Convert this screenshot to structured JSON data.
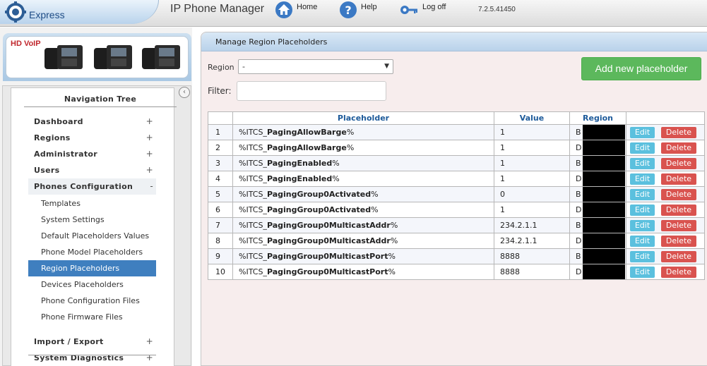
{
  "header": {
    "brand": "Express",
    "title": "IP Phone Manager",
    "home_label": "Home",
    "help_label": "Help",
    "logoff_label": "Log off",
    "version": "7.2.5.41450"
  },
  "banner": {
    "logo_text": "HD VoIP"
  },
  "nav": {
    "title": "Navigation Tree",
    "items": [
      {
        "label": "Dashboard",
        "type": "top",
        "toggle": "+"
      },
      {
        "label": "Regions",
        "type": "top",
        "toggle": "+"
      },
      {
        "label": "Administrator",
        "type": "top",
        "toggle": "+"
      },
      {
        "label": "Users",
        "type": "top",
        "toggle": "+"
      },
      {
        "label": "Phones Configuration",
        "type": "top",
        "toggle": "-"
      },
      {
        "label": "Templates",
        "type": "sub"
      },
      {
        "label": "System Settings",
        "type": "sub"
      },
      {
        "label": "Default Placeholders Values",
        "type": "sub"
      },
      {
        "label": "Phone Model Placeholders",
        "type": "sub"
      },
      {
        "label": "Region Placeholders",
        "type": "sub",
        "active": true
      },
      {
        "label": "Devices Placeholders",
        "type": "sub"
      },
      {
        "label": "Phone Configuration Files",
        "type": "sub"
      },
      {
        "label": "Phone Firmware Files",
        "type": "sub"
      },
      {
        "label": "Import / Export",
        "type": "top",
        "toggle": "+"
      },
      {
        "label": "System Diagnostics",
        "type": "top",
        "toggle": "+"
      }
    ]
  },
  "main": {
    "panel_title": "Manage Region Placeholders",
    "region_label": "Region",
    "region_value": "-",
    "filter_label": "Filter:",
    "filter_value": "",
    "add_button": "Add new placeholder",
    "columns": [
      "",
      "Placeholder",
      "Value",
      "Region",
      ""
    ],
    "edit_label": "Edit",
    "delete_label": "Delete",
    "rows": [
      {
        "n": "1",
        "prefix": "%ITCS_",
        "name": "PagingAllowBarge",
        "suffix": "%",
        "value": "1",
        "region": "B"
      },
      {
        "n": "2",
        "prefix": "%ITCS_",
        "name": "PagingAllowBarge",
        "suffix": "%",
        "value": "1",
        "region": "D"
      },
      {
        "n": "3",
        "prefix": "%ITCS_",
        "name": "PagingEnabled",
        "suffix": "%",
        "value": "1",
        "region": "B"
      },
      {
        "n": "4",
        "prefix": "%ITCS_",
        "name": "PagingEnabled",
        "suffix": "%",
        "value": "1",
        "region": "D"
      },
      {
        "n": "5",
        "prefix": "%ITCS_",
        "name": "PagingGroup0Activated",
        "suffix": "%",
        "value": "0",
        "region": "B"
      },
      {
        "n": "6",
        "prefix": "%ITCS_",
        "name": "PagingGroup0Activated",
        "suffix": "%",
        "value": "1",
        "region": "D"
      },
      {
        "n": "7",
        "prefix": "%ITCS_",
        "name": "PagingGroup0MulticastAddr",
        "suffix": "%",
        "value": "234.2.1.1",
        "region": "B"
      },
      {
        "n": "8",
        "prefix": "%ITCS_",
        "name": "PagingGroup0MulticastAddr",
        "suffix": "%",
        "value": "234.2.1.1",
        "region": "D"
      },
      {
        "n": "9",
        "prefix": "%ITCS_",
        "name": "PagingGroup0MulticastPort",
        "suffix": "%",
        "value": "8888",
        "region": "B"
      },
      {
        "n": "10",
        "prefix": "%ITCS_",
        "name": "PagingGroup0MulticastPort",
        "suffix": "%",
        "value": "8888",
        "region": "D"
      }
    ]
  },
  "colors": {
    "accent": "#3f7fbf",
    "add": "#5cb85c",
    "edit": "#5bc0de",
    "delete": "#d9534f",
    "header_text": "#1d5a9a"
  }
}
